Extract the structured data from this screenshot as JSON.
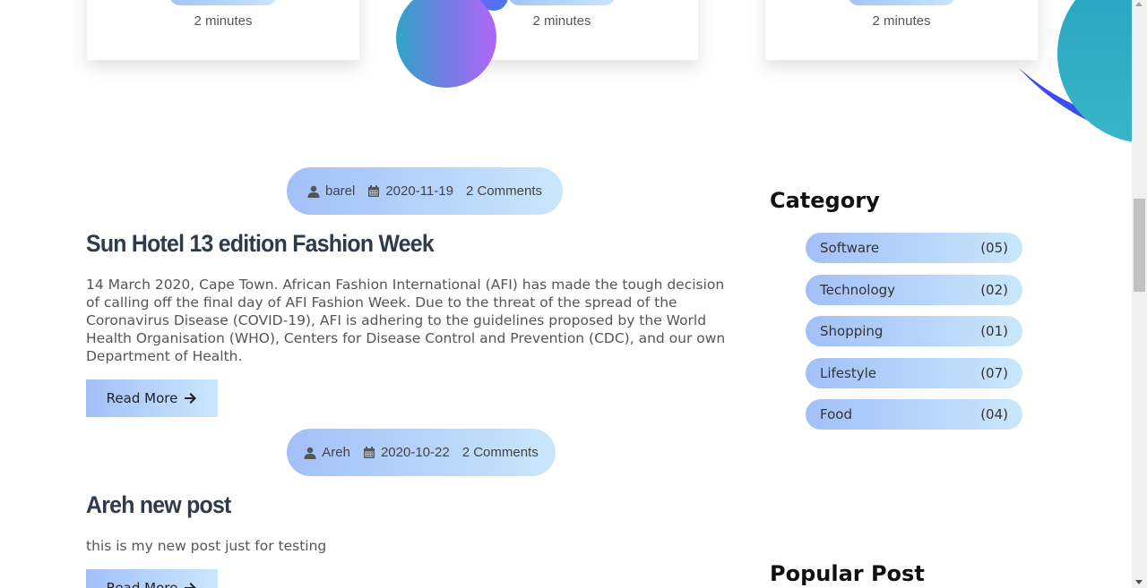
{
  "cards": [
    {
      "duration": "2 minutes"
    },
    {
      "duration": "2 minutes"
    },
    {
      "duration": "2 minutes"
    }
  ],
  "posts": [
    {
      "author": "barel",
      "date": "2020-11-19",
      "comments": "2 Comments",
      "title": "Sun Hotel 13 edition Fashion Week",
      "excerpt": "14 March 2020, Cape Town. African Fashion International (AFI) has made the tough decision of calling off the final day of AFI Fashion Week. Due to the threat of the spread of the Coronavirus Disease (COVID-19), AFI is adhering to the guidelines proposed by the World Health Organisation (WHO), Centers for Disease Control and Prevention (CDC), and our own Department of Health.",
      "read_more": "Read More"
    },
    {
      "author": "Areh",
      "date": "2020-10-22",
      "comments": "2 Comments",
      "title": "Areh new post",
      "excerpt": "this is my new post just for testing",
      "read_more": "Read More"
    }
  ],
  "sidebar": {
    "category_heading": "Category",
    "categories": [
      {
        "name": "Software",
        "count": "(05)"
      },
      {
        "name": "Technology",
        "count": "(02)"
      },
      {
        "name": "Shopping",
        "count": "(01)"
      },
      {
        "name": "Lifestyle",
        "count": "(07)"
      },
      {
        "name": "Food",
        "count": "(04)"
      }
    ],
    "popular_heading": "Popular Post"
  },
  "colors": {
    "pill_gradient_start": "#a2c0f8",
    "pill_gradient_end": "#c9e7fb",
    "title": "#2f3a4a"
  },
  "icons": [
    "user-icon",
    "calendar-icon",
    "arrow-right-icon"
  ]
}
